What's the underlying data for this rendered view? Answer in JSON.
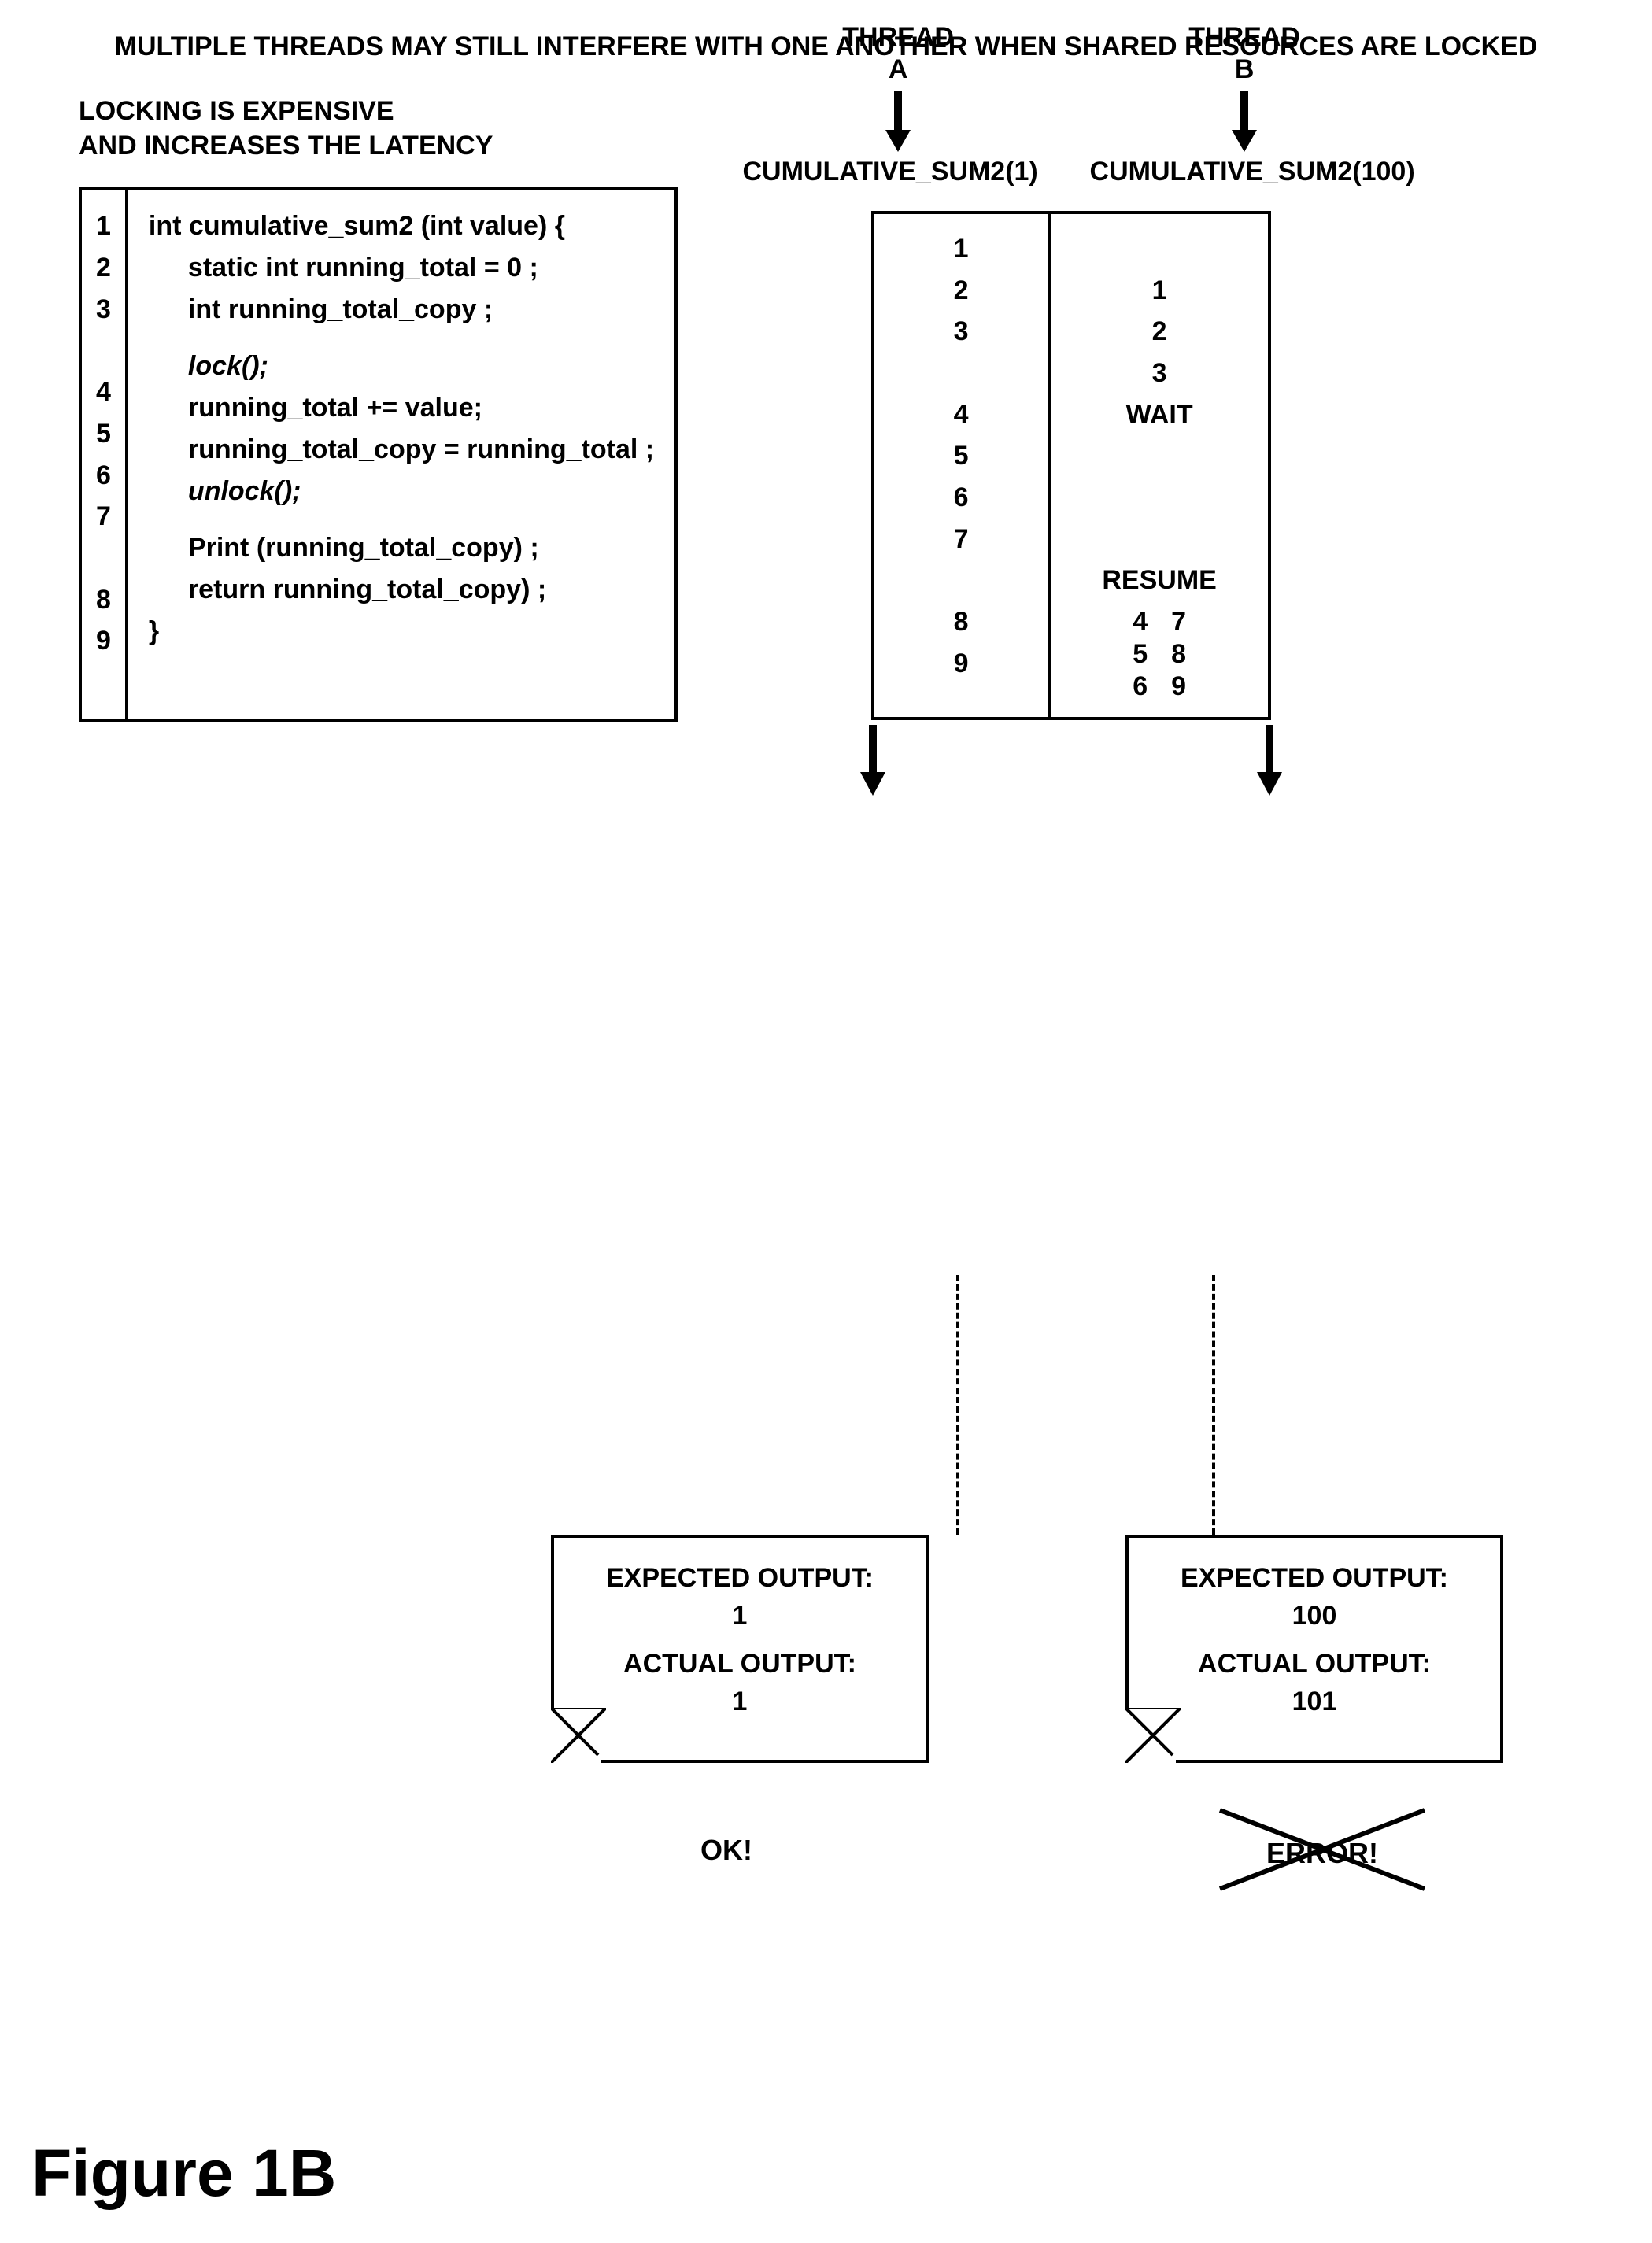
{
  "title": "MULTIPLE THREADS MAY STILL INTERFERE WITH ONE ANOTHER WHEN SHARED RESOURCES ARE LOCKED",
  "subtitle1": "LOCKING IS EXPENSIVE",
  "subtitle2": "AND INCREASES THE LATENCY",
  "code": {
    "rows": [
      "1",
      "2",
      "3",
      "",
      "4",
      "5",
      "6",
      "7",
      "",
      "8",
      "9",
      ""
    ],
    "l1": "int   cumulative_sum2 (int value) {",
    "l2": "static int running_total = 0 ;",
    "l3": "int  running_total_copy ;",
    "l4": "lock();",
    "l5": "running_total  += value;",
    "l6": "running_total_copy = running_total ;",
    "l7": "unlock();",
    "l8": "Print (running_total_copy) ;",
    "l9": "return running_total_copy) ;",
    "l10": "}"
  },
  "threads": {
    "a_header1": "THREAD",
    "a_header2": "A",
    "b_header1": "THREAD",
    "b_header2": "B",
    "a_call": "CUMULATIVE_SUM2(1)",
    "b_call": "CUMULATIVE_SUM2(100)",
    "a_seq": [
      "1",
      "2",
      "3",
      "",
      "4",
      "5",
      "6",
      "7",
      "",
      "8",
      "9"
    ],
    "b_seq_top": [
      "",
      "1",
      "2",
      "3",
      "WAIT"
    ],
    "b_resume": "RESUME",
    "b_seq_bot": [
      "4",
      "5",
      "6",
      "7",
      "8",
      "9"
    ]
  },
  "outputs": {
    "a": {
      "exp_label": "EXPECTED OUTPUT:",
      "exp_val": "1",
      "act_label": "ACTUAL OUTPUT:",
      "act_val": "1",
      "verdict": "OK!"
    },
    "b": {
      "exp_label": "EXPECTED OUTPUT:",
      "exp_val": "100",
      "act_label": "ACTUAL OUTPUT:",
      "act_val": "101",
      "verdict": "ERROR!"
    }
  },
  "figure": "Figure 1B",
  "chart_data": {
    "type": "table",
    "description": "Diagram showing two threads A and B executing cumulative_sum2 with a lock. Thread A calls cumulative_sum2(1) lines 1-9 and gets output 1 (correct). Thread B calls cumulative_sum2(100), executes lines 1-3, WAITs on lock while A holds it (A lines 4-7), then RESUMEs lines 4-9 and gets output 101 instead of expected 100 (ERROR).",
    "threads": [
      {
        "name": "A",
        "call": "CUMULATIVE_SUM2(1)",
        "execution": [
          1,
          2,
          3,
          4,
          5,
          6,
          7,
          8,
          9
        ],
        "expected": 1,
        "actual": 1,
        "status": "OK"
      },
      {
        "name": "B",
        "call": "CUMULATIVE_SUM2(100)",
        "execution": [
          1,
          2,
          3,
          "WAIT",
          "RESUME",
          4,
          5,
          6,
          7,
          8,
          9
        ],
        "expected": 100,
        "actual": 101,
        "status": "ERROR"
      }
    ]
  }
}
